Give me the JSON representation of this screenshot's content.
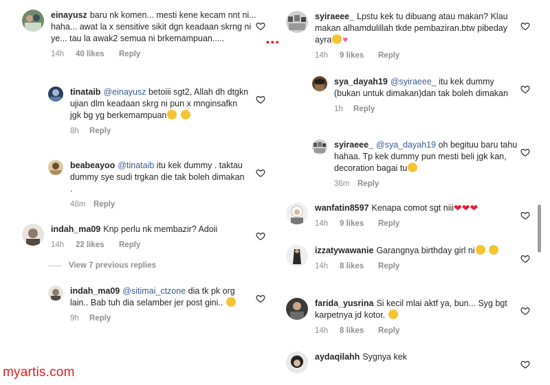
{
  "left": {
    "comments": [
      {
        "user": "einayusz",
        "text": "baru nk komen... mesti kene kecam nnt ni... haha... awat la x sensitive sikit dgn keadaan skrng ni ye... tau la awak2 semua ni brkemampuan.....",
        "time": "14h",
        "likes": "40 likes",
        "reply": "Reply"
      },
      {
        "user": "tinataib",
        "mention": "@einayusz",
        "text": "betoiii sgt2, Allah dh dtgkn ujian dlm keadaan skrg ni pun x mnginsafkn jgk bg yg berkemampuan",
        "time": "8h",
        "reply": "Reply"
      },
      {
        "user": "beabeayoo",
        "mention": "@tinataib",
        "text": "itu kek dummy . taktau dummy sye sudi trgkan die tak boleh dimakan .",
        "time": "48m",
        "reply": "Reply"
      },
      {
        "user": "indah_ma09",
        "text": "Knp perlu nk membazir? Adoii",
        "time": "14h",
        "likes": "22 likes",
        "reply": "Reply"
      },
      {
        "user": "indah_ma09",
        "mention": "@sitimai_ctzone",
        "text": "dia tk pk org lain.. Bab tuh dia selamber jer post gini..",
        "time": "9h",
        "reply": "Reply"
      }
    ],
    "view_replies": "View 7 previous replies"
  },
  "right": {
    "comments": [
      {
        "user": "syiraeee_",
        "text": "Lpstu kek tu dibuang atau makan? Klau makan alhamdulillah tkde pembaziran.btw pibeday ayra",
        "time": "14h",
        "likes": "9 likes",
        "reply": "Reply"
      },
      {
        "user": "sya_dayah19",
        "mention": "@syiraeee_",
        "text": "itu kek dummy (bukan untuk dimakan)dan tak boleh dimakan",
        "time": "1h",
        "reply": "Reply"
      },
      {
        "user": "syiraeee_",
        "mention": "@sya_dayah19",
        "text": "oh begituu baru tahu hahaa. Tp kek dummy pun mesti beli jgk kan, decoration bagai tu",
        "time": "36m",
        "reply": "Reply"
      },
      {
        "user": "wanfatin8597",
        "text": "Kenapa comot sgt niii",
        "time": "14h",
        "likes": "9 likes",
        "reply": "Reply"
      },
      {
        "user": "izzatywawanie",
        "text": "Garangnya birthday girl ni",
        "time": "14h",
        "likes": "8 likes",
        "reply": "Reply"
      },
      {
        "user": "farida_yusrina",
        "text": "Si kecil mlai aktf ya, bun... Syg bgt karpetnya jd kotor.",
        "time": "14h",
        "likes": "8 likes",
        "reply": "Reply"
      },
      {
        "user": "aydaqilahh",
        "text": "Sygnya kek"
      }
    ]
  },
  "watermark": "myartis.com",
  "colors": {
    "text": "#262626",
    "meta": "#8e8e8e",
    "mention": "#3a5b8f",
    "watermark": "#e21a1a",
    "heart_outline": "#262626"
  },
  "icons": {
    "like": "heart-outline-icon",
    "emoji_face": "emoji-face-icon",
    "emoji_red_heart": "red-heart-emoji",
    "emoji_pink_heart": "pink-heart-emoji"
  }
}
